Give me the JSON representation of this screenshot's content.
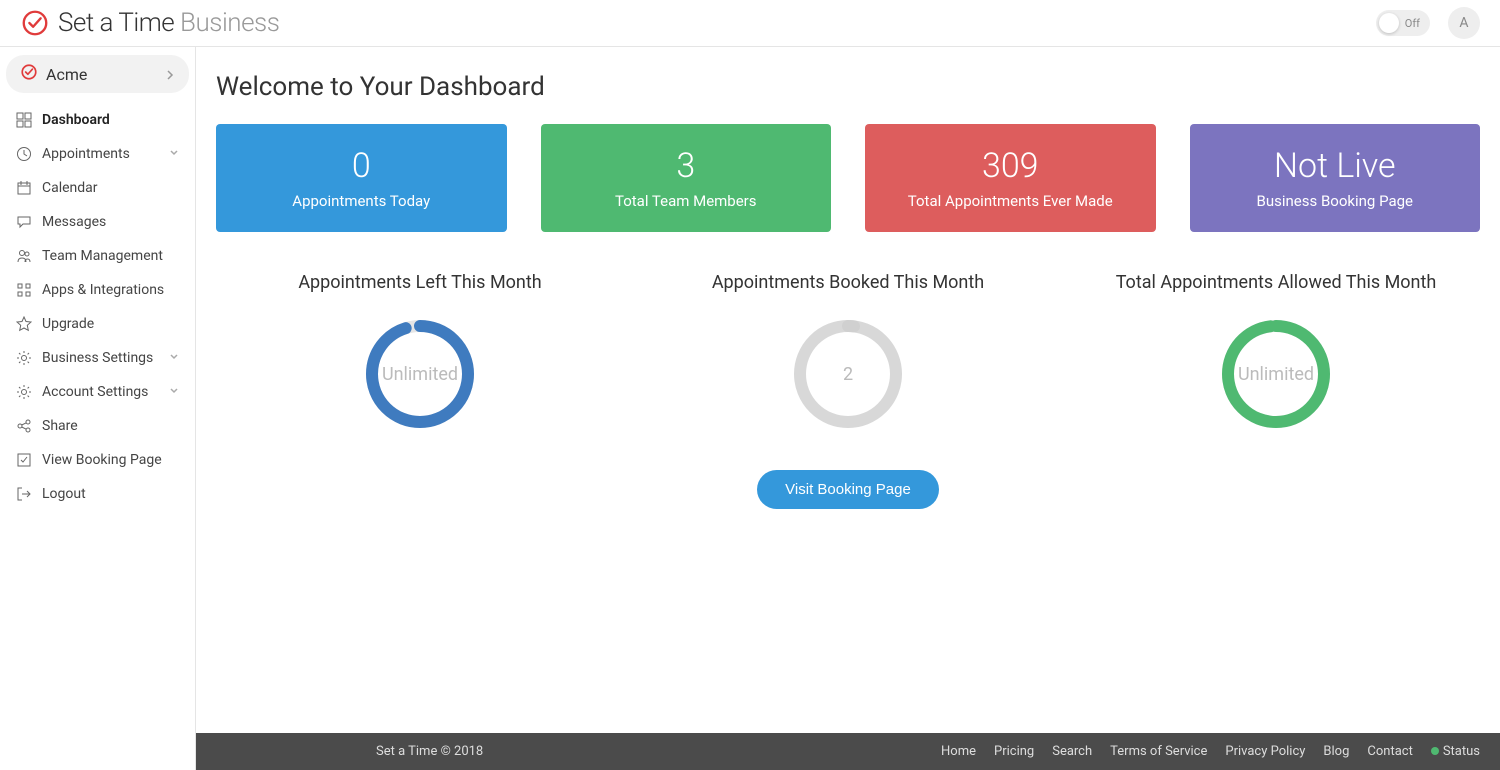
{
  "header": {
    "logo_main": "Set a Time",
    "logo_sub": "Business",
    "toggle_label": "Off",
    "avatar_initial": "A"
  },
  "sidebar": {
    "org_name": "Acme",
    "items": [
      {
        "label": "Dashboard",
        "icon": "dashboard-icon",
        "active": true
      },
      {
        "label": "Appointments",
        "icon": "clock-icon",
        "expandable": true
      },
      {
        "label": "Calendar",
        "icon": "calendar-icon"
      },
      {
        "label": "Messages",
        "icon": "chat-icon"
      },
      {
        "label": "Team Management",
        "icon": "team-icon"
      },
      {
        "label": "Apps & Integrations",
        "icon": "apps-icon"
      },
      {
        "label": "Upgrade",
        "icon": "star-icon"
      },
      {
        "label": "Business Settings",
        "icon": "gear-icon",
        "expandable": true
      },
      {
        "label": "Account Settings",
        "icon": "gear-icon",
        "expandable": true
      },
      {
        "label": "Share",
        "icon": "share-icon"
      },
      {
        "label": "View Booking Page",
        "icon": "checkbox-icon"
      },
      {
        "label": "Logout",
        "icon": "logout-icon"
      }
    ]
  },
  "main": {
    "title": "Welcome to Your Dashboard",
    "stat_cards": [
      {
        "value": "0",
        "label": "Appointments Today",
        "color": "c-blue"
      },
      {
        "value": "3",
        "label": "Total Team Members",
        "color": "c-green"
      },
      {
        "value": "309",
        "label": "Total Appointments Ever Made",
        "color": "c-red"
      },
      {
        "value": "Not Live",
        "label": "Business Booking Page",
        "color": "c-purple"
      }
    ],
    "gauges": [
      {
        "title": "Appointments Left This Month",
        "center": "Unlimited",
        "color": "#3f7bbf",
        "pct": 95,
        "bg": "#e5e5e5"
      },
      {
        "title": "Appointments Booked This Month",
        "center": "2",
        "color": "#d0d0d0",
        "pct": 2,
        "bg": "#d8d8d8"
      },
      {
        "title": "Total Appointments Allowed This Month",
        "center": "Unlimited",
        "color": "#4fb971",
        "pct": 98,
        "bg": "#e5e5e5"
      }
    ],
    "visit_button": "Visit Booking Page"
  },
  "footer": {
    "copyright": "Set a Time © 2018",
    "links": [
      "Home",
      "Pricing",
      "Search",
      "Terms of Service",
      "Privacy Policy",
      "Blog",
      "Contact"
    ],
    "status_label": "Status"
  }
}
